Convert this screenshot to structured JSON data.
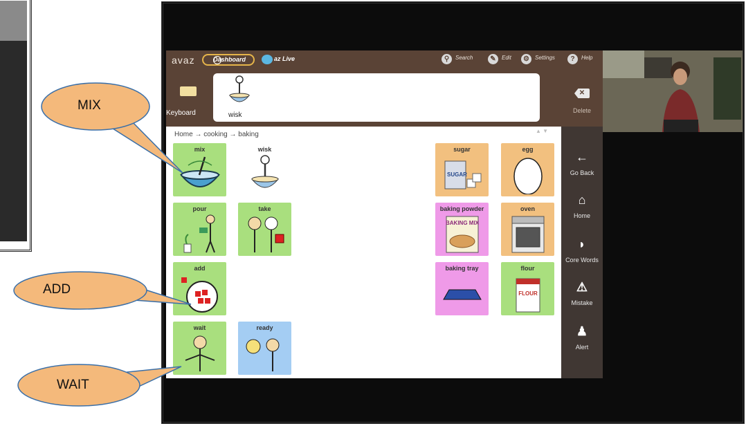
{
  "app": {
    "logo": "avaz",
    "dashboard_label": "Dashboard",
    "live_label": "az Live",
    "search_label": "Search",
    "edit_label": "Edit",
    "settings_label": "Settings",
    "help_label": "Help"
  },
  "sentence_bar": {
    "keyboard_label": "Keyboard",
    "words": [
      {
        "label": "wisk"
      }
    ],
    "delete_label": "Delete"
  },
  "breadcrumb": {
    "items": [
      "Home",
      "cooking",
      "baking"
    ],
    "separator": "→"
  },
  "grid": {
    "tiles": [
      {
        "label": "mix",
        "color": "#a9df7e"
      },
      {
        "label": "wisk",
        "color": "#ffffff"
      },
      {
        "label": "sugar",
        "color": "#f2c07f"
      },
      {
        "label": "egg",
        "color": "#f2c07f"
      },
      {
        "label": "pour",
        "color": "#a9df7e"
      },
      {
        "label": "take",
        "color": "#a9df7e"
      },
      {
        "label": "baking powder",
        "color": "#ef9ae8"
      },
      {
        "label": "oven",
        "color": "#f2c07f"
      },
      {
        "label": "add",
        "color": "#a9df7e"
      },
      {
        "label": "baking tray",
        "color": "#ef9ae8"
      },
      {
        "label": "flour",
        "color": "#a9df7e"
      },
      {
        "label": "wait",
        "color": "#a9df7e"
      },
      {
        "label": "ready",
        "color": "#a4cdf3"
      }
    ],
    "picture_text": {
      "sugar": "SUGAR",
      "baking_mix": "BAKING MIX",
      "flour": "FLOUR"
    }
  },
  "nav": {
    "go_back": "Go Back",
    "home": "Home",
    "core_words": "Core Words",
    "mistake": "Mistake",
    "alert": "Alert"
  },
  "callouts": {
    "mix": "MIX",
    "add": "ADD",
    "wait": "WAIT"
  },
  "colors": {
    "topbar": "#5a4336",
    "nav": "#403733",
    "callout": "#f4b97b"
  }
}
